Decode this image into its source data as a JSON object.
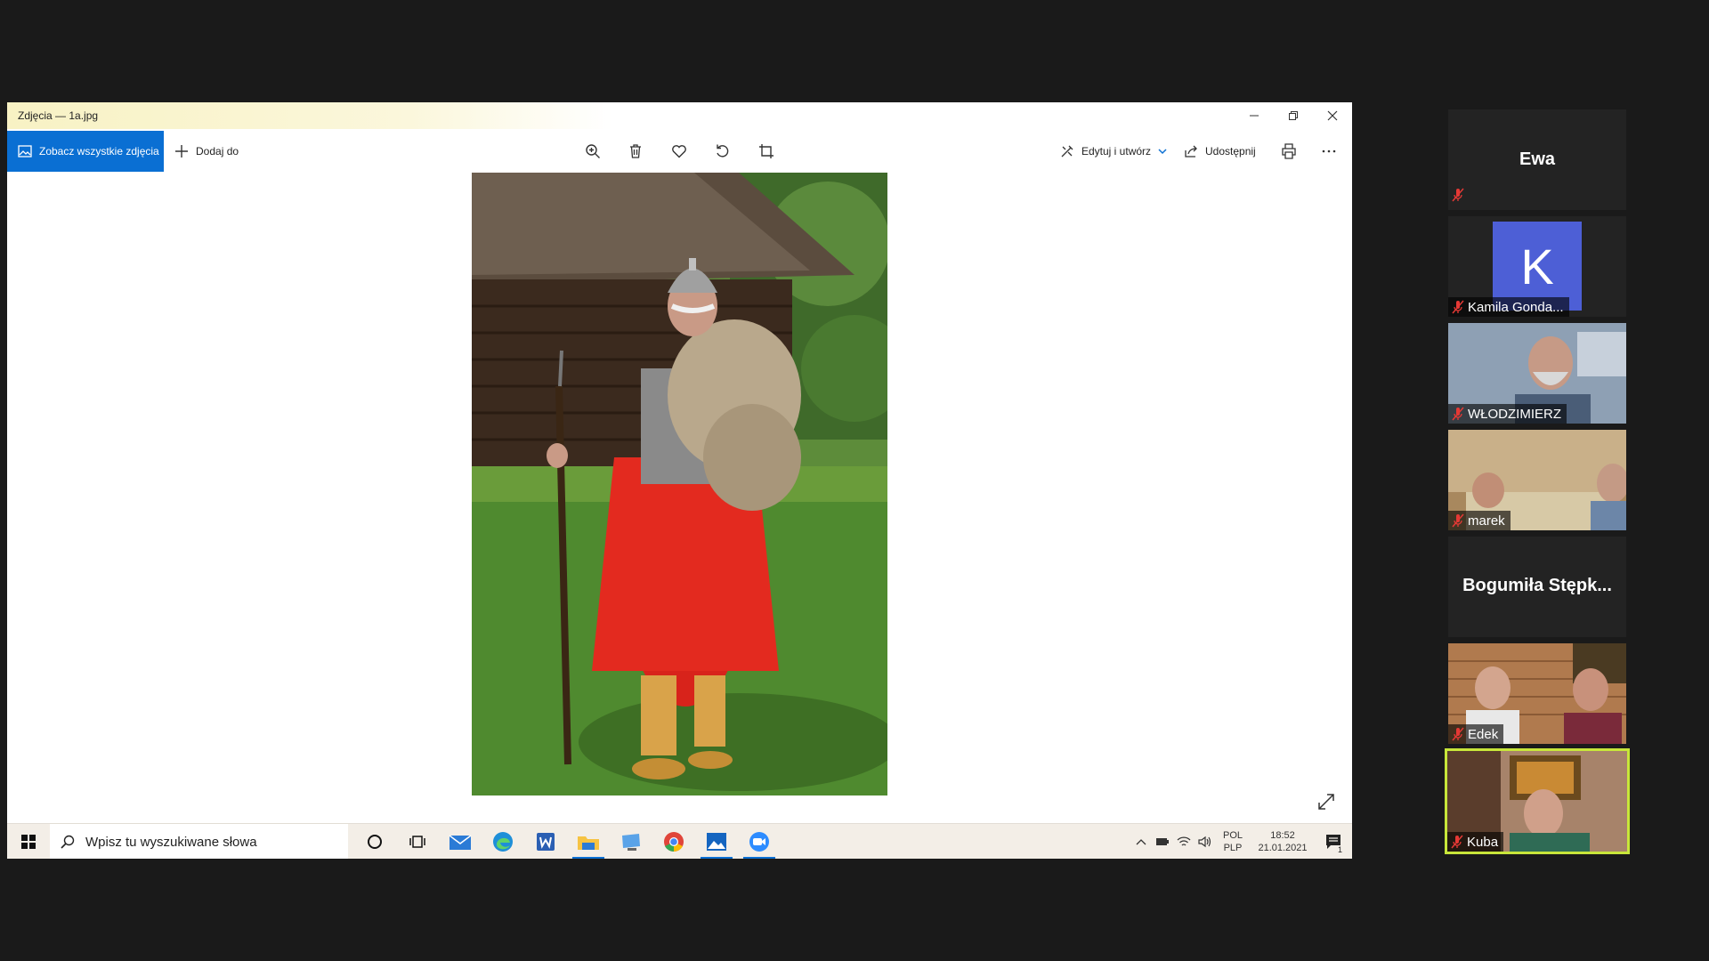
{
  "window": {
    "title": "Zdjęcia — 1a.jpg"
  },
  "toolbar": {
    "see_all_label": "Zobacz wszystkie zdjęcia",
    "add_to_label": "Dodaj do",
    "edit_create_label": "Edytuj i utwórz",
    "share_label": "Udostępnij"
  },
  "taskbar": {
    "search_placeholder": "Wpisz tu wyszukiwane słowa",
    "language_top": "POL",
    "language_bottom": "PLP",
    "time": "18:52",
    "date": "21.01.2021",
    "notification_count": "1"
  },
  "participants": [
    {
      "name": "Ewa",
      "muted": true,
      "video": false
    },
    {
      "name": "Kamila Gonda...",
      "avatar_letter": "K",
      "muted": true,
      "video": false
    },
    {
      "name": "WŁODZIMIERZ",
      "muted": true,
      "video": true
    },
    {
      "name": "marek",
      "muted": true,
      "video": true
    },
    {
      "name": "Bogumiła Stępk...",
      "muted": false,
      "video": false
    },
    {
      "name": "Edek",
      "muted": true,
      "video": true
    },
    {
      "name": "Kuba",
      "muted": true,
      "video": true,
      "active_speaker": true
    }
  ],
  "colors": {
    "accent": "#0a6fd3",
    "active_speaker_border": "#c8e63a",
    "mic_muted": "#e53935",
    "avatar_k": "#4d5fd6"
  }
}
